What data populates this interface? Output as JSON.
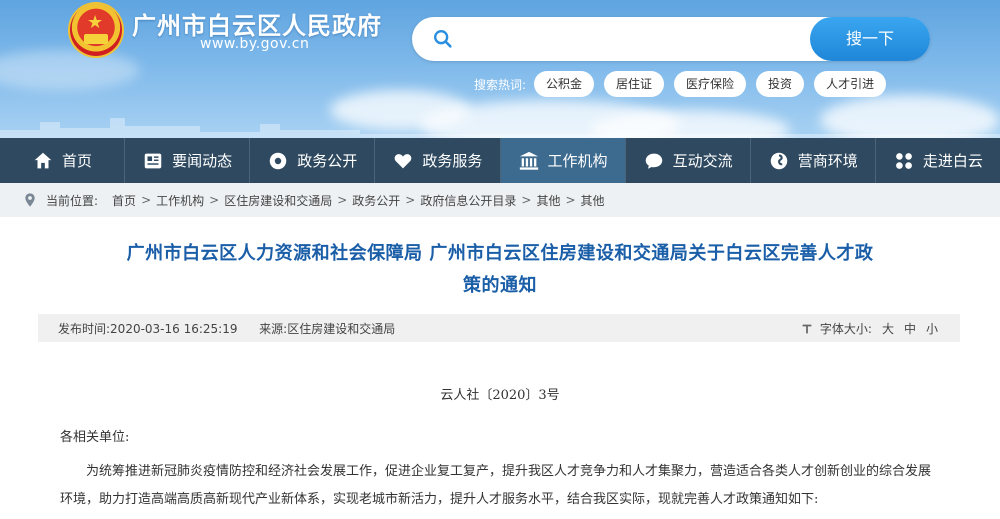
{
  "header": {
    "site_title": "广州市白云区人民政府",
    "site_url": "www.by.gov.cn",
    "search": {
      "placeholder": "",
      "button_label": "搜一下"
    },
    "hot_label": "搜索热词:",
    "hot_tags": [
      "公积金",
      "居住证",
      "医疗保险",
      "投资",
      "人才引进"
    ]
  },
  "nav": {
    "items": [
      {
        "label": "首页",
        "icon": "home-icon"
      },
      {
        "label": "要闻动态",
        "icon": "news-icon"
      },
      {
        "label": "政务公开",
        "icon": "gear-icon"
      },
      {
        "label": "政务服务",
        "icon": "heart-icon"
      },
      {
        "label": "工作机构",
        "icon": "building-icon",
        "active": true
      },
      {
        "label": "互动交流",
        "icon": "chat-icon"
      },
      {
        "label": "营商环境",
        "icon": "swirl-icon"
      },
      {
        "label": "走进白云",
        "icon": "grid-icon"
      }
    ],
    "colors": {
      "bar": "#2f4a60",
      "active": "#3d6a8f"
    }
  },
  "breadcrumb": {
    "label": "当前位置:",
    "items": [
      "首页",
      "工作机构",
      "区住房建设和交通局",
      "政务公开",
      "政府信息公开目录",
      "其他",
      "其他"
    ]
  },
  "article": {
    "title_line1": "广州市白云区人力资源和社会保障局 广州市白云区住房建设和交通局关于白云区完善人才政",
    "title_line2": "策的通知",
    "publish_time": "发布时间:2020-03-16 16:25:19",
    "source": "来源:区住房建设和交通局",
    "font_size_label": "字体大小:",
    "font_sizes": [
      "大",
      "中",
      "小"
    ],
    "doc_number": "云人社〔2020〕3号",
    "salutation": "各相关单位:",
    "body": "为统筹推进新冠肺炎疫情防控和经济社会发展工作，促进企业复工复产，提升我区人才竞争力和人才集聚力，营造适合各类人才创新创业的综合发展环境，助力打造高端高质高新现代产业新体系，实现老城市新活力，提升人才服务水平，结合我区实际，现就完善人才政策通知如下:"
  }
}
